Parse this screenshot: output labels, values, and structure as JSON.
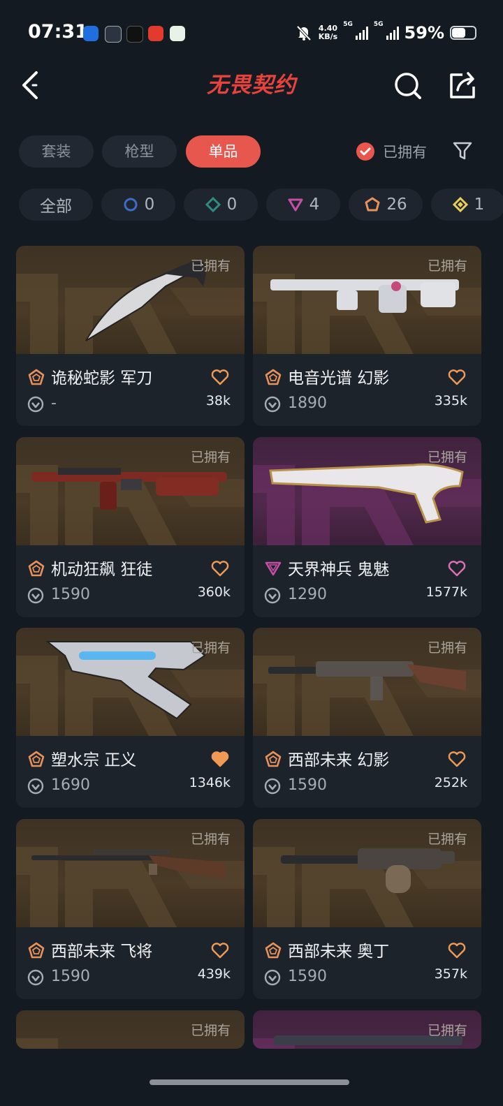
{
  "status_bar": {
    "time": "07:31",
    "net_speed_value": "4.40",
    "net_speed_unit": "KB/s",
    "sim1": "5G",
    "sim2": "5G",
    "battery": "59%",
    "battery_level": 0.59
  },
  "header": {
    "title": "无畏契约",
    "back_icon": "chevron-left-icon",
    "search_icon": "search-icon",
    "share_icon": "share-icon"
  },
  "tabs": [
    {
      "label": "套装",
      "active": false
    },
    {
      "label": "枪型",
      "active": false
    },
    {
      "label": "单品",
      "active": true
    }
  ],
  "owned_filter": {
    "label": "已拥有",
    "checked": true
  },
  "rarity_chips": [
    {
      "label": "全部",
      "count": ""
    },
    {
      "icon": "select-tier-icon",
      "count": "0",
      "color": "#3a6ec4"
    },
    {
      "icon": "deluxe-tier-icon",
      "count": "0",
      "color": "#2e8c80"
    },
    {
      "icon": "premium-tier-icon",
      "count": "4",
      "color": "#c64fa6"
    },
    {
      "icon": "exclusive-tier-icon",
      "count": "26",
      "color": "#e8915a"
    },
    {
      "icon": "ultra-tier-icon",
      "count": "1",
      "color": "#e8cf5a"
    }
  ],
  "items": [
    {
      "name": "诡秘蛇影 军刀",
      "owned": "已拥有",
      "price": "-",
      "likes": "38k",
      "tier": "exclusive",
      "liked": false,
      "bg": "brown"
    },
    {
      "name": "电音光谱 幻影",
      "owned": "已拥有",
      "price": "1890",
      "likes": "335k",
      "tier": "exclusive",
      "liked": false,
      "bg": "brown"
    },
    {
      "name": "机动狂飙 狂徒",
      "owned": "已拥有",
      "price": "1590",
      "likes": "360k",
      "tier": "exclusive",
      "liked": false,
      "bg": "brown"
    },
    {
      "name": "天界神兵 鬼魅",
      "owned": "已拥有",
      "price": "1290",
      "likes": "1577k",
      "tier": "premium",
      "liked": false,
      "bg": "purple"
    },
    {
      "name": "塑水宗 正义",
      "owned": "已拥有",
      "price": "1690",
      "likes": "1346k",
      "tier": "exclusive",
      "liked": true,
      "bg": "brown"
    },
    {
      "name": "西部未来 幻影",
      "owned": "已拥有",
      "price": "1590",
      "likes": "252k",
      "tier": "exclusive",
      "liked": false,
      "bg": "brown"
    },
    {
      "name": "西部未来 飞将",
      "owned": "已拥有",
      "price": "1590",
      "likes": "439k",
      "tier": "exclusive",
      "liked": false,
      "bg": "brown"
    },
    {
      "name": "西部未来 奥丁",
      "owned": "已拥有",
      "price": "1590",
      "likes": "357k",
      "tier": "exclusive",
      "liked": false,
      "bg": "brown"
    },
    {
      "owned": "已拥有",
      "bg": "brown"
    },
    {
      "owned": "已拥有",
      "bg": "purple"
    }
  ],
  "colors": {
    "accent": "#e8574e",
    "exclusive": "#e8915a",
    "premium": "#c64fa6",
    "background": "#141a22"
  }
}
